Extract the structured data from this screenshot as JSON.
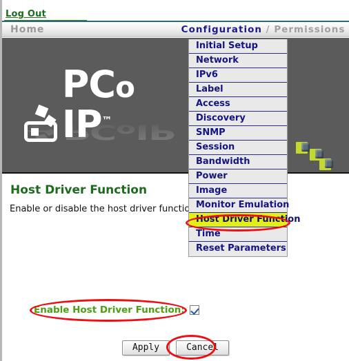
{
  "header": {
    "logout_label": "Log Out"
  },
  "nav": {
    "home_label": "Home",
    "configuration_label": "Configuration",
    "separator": " / ",
    "permissions_label": "Permissions",
    "trailing_separator": " /"
  },
  "banner": {
    "logo_prefix": "PC",
    "logo_o": "o",
    "logo_suffix": "IP",
    "logo_tm": "™"
  },
  "menu": {
    "items": [
      {
        "label": "Initial Setup",
        "active": false
      },
      {
        "label": "Network",
        "active": false
      },
      {
        "label": "IPv6",
        "active": false
      },
      {
        "label": "Label",
        "active": false
      },
      {
        "label": "Access",
        "active": false
      },
      {
        "label": "Discovery",
        "active": false
      },
      {
        "label": "SNMP",
        "active": false
      },
      {
        "label": "Session",
        "active": false
      },
      {
        "label": "Bandwidth",
        "active": false
      },
      {
        "label": "Power",
        "active": false
      },
      {
        "label": "Image",
        "active": false
      },
      {
        "label": "Monitor Emulation",
        "active": false
      },
      {
        "label": "Host Driver Function",
        "active": true
      },
      {
        "label": "Time",
        "active": false
      },
      {
        "label": "Reset Parameters",
        "active": false
      }
    ]
  },
  "main": {
    "title": "Host Driver Function",
    "description": "Enable or disable the host driver function",
    "checkbox_label": "Enable Host Driver Function:",
    "checkbox_checked": true
  },
  "buttons": {
    "apply_label": "Apply",
    "cancel_label": "Cancel"
  },
  "colors": {
    "annotation_red": "#ee0d11",
    "highlight_yellow": "#e3ef18",
    "menu_text_blue": "#141482",
    "title_green": "#1d6b1d",
    "label_green": "#4c9e14",
    "banner_gray": "#5b5b5b"
  }
}
